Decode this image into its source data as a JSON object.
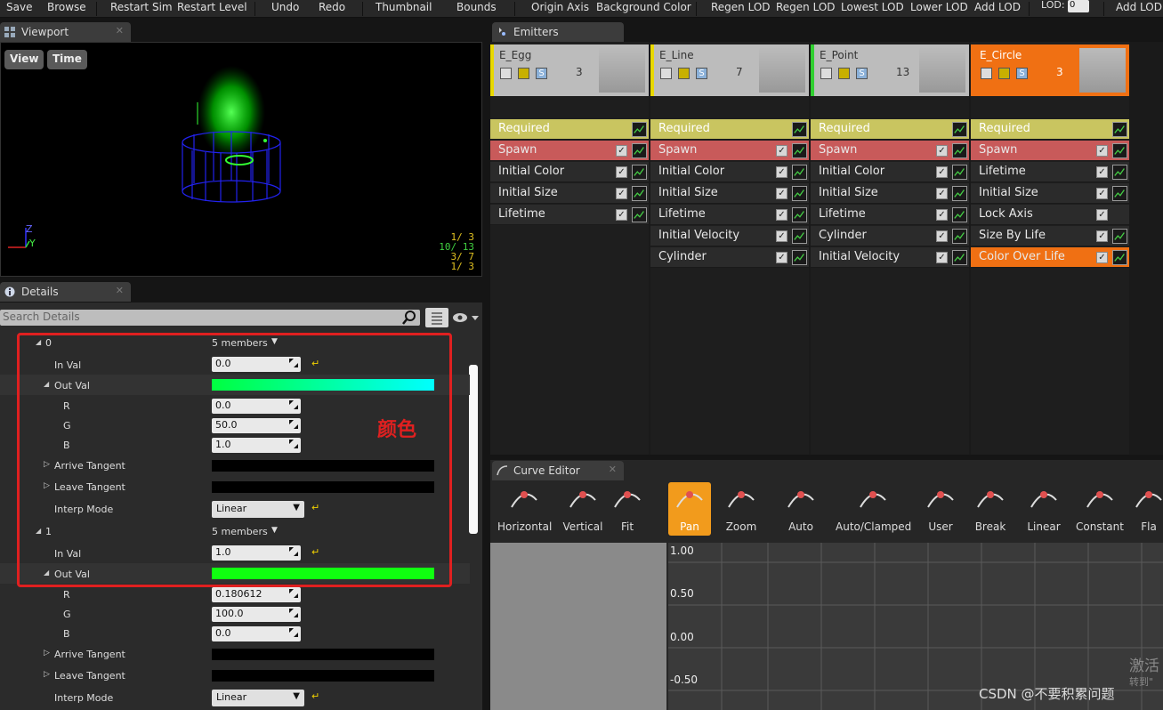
{
  "toolbar": {
    "items": [
      "Save",
      "Browse",
      "Restart Sim",
      "Restart Level",
      "Undo",
      "Redo",
      "Thumbnail",
      "Bounds",
      "Origin Axis",
      "Background Color",
      "Regen LOD",
      "Regen LOD",
      "Lowest LOD",
      "Lower LOD",
      "Add LOD",
      "LOD:",
      "Add LOD"
    ],
    "lod_value": "0"
  },
  "viewport": {
    "tab": "Viewport",
    "buttons": [
      "View",
      "Time"
    ],
    "axis": {
      "z": "Z",
      "y": "Y"
    },
    "stats": [
      {
        "text": "1/ 3",
        "color": "#e0c020"
      },
      {
        "text": "10/ 13",
        "color": "#40d040"
      },
      {
        "text": "3/ 7",
        "color": "#e0c020"
      },
      {
        "text": "1/ 3",
        "color": "#e0c020"
      }
    ]
  },
  "details": {
    "tab": "Details",
    "search_placeholder": "Search Details",
    "annotation": "颜色",
    "rows": [
      {
        "label": "0",
        "kind": "group",
        "value": "5 members"
      },
      {
        "label": "In Val",
        "kind": "num",
        "value": "0.0"
      },
      {
        "label": "Out Val",
        "kind": "color"
      },
      {
        "label": "R",
        "kind": "num",
        "value": "0.0"
      },
      {
        "label": "G",
        "kind": "num",
        "value": "50.0"
      },
      {
        "label": "B",
        "kind": "num",
        "value": "1.0"
      },
      {
        "label": "Arrive Tangent",
        "kind": "bar"
      },
      {
        "label": "Leave Tangent",
        "kind": "bar"
      },
      {
        "label": "Interp Mode",
        "kind": "drop",
        "value": "Linear"
      },
      {
        "label": "1",
        "kind": "group",
        "value": "5 members"
      },
      {
        "label": "In Val",
        "kind": "num",
        "value": "1.0"
      },
      {
        "label": "Out Val",
        "kind": "color"
      },
      {
        "label": "R",
        "kind": "num",
        "value": "0.180612"
      },
      {
        "label": "G",
        "kind": "num",
        "value": "100.0"
      },
      {
        "label": "B",
        "kind": "num",
        "value": "0.0"
      },
      {
        "label": "Arrive Tangent",
        "kind": "bar"
      },
      {
        "label": "Leave Tangent",
        "kind": "bar"
      },
      {
        "label": "Interp Mode",
        "kind": "drop",
        "value": "Linear"
      }
    ]
  },
  "emitters": {
    "tab": "Emitters",
    "columns": [
      {
        "name": "E_Egg",
        "count": "3",
        "stripe": "#e8d800",
        "selected": false,
        "modules": [
          "Required",
          "Spawn",
          "Initial Color",
          "Initial Size",
          "Lifetime"
        ]
      },
      {
        "name": "E_Line",
        "count": "7",
        "stripe": "#e8d800",
        "selected": false,
        "modules": [
          "Required",
          "Spawn",
          "Initial Color",
          "Initial Size",
          "Lifetime",
          "Initial Velocity",
          "Cylinder"
        ]
      },
      {
        "name": "E_Point",
        "count": "13",
        "stripe": "#30d030",
        "selected": false,
        "modules": [
          "Required",
          "Spawn",
          "Initial Color",
          "Initial Size",
          "Lifetime",
          "Cylinder",
          "Initial Velocity"
        ]
      },
      {
        "name": "E_Circle",
        "count": "3",
        "stripe": "#f07013",
        "selected": true,
        "modules": [
          "Required",
          "Spawn",
          "Lifetime",
          "Initial Size",
          "Lock Axis",
          "Size By Life",
          "Color Over Life"
        ]
      }
    ]
  },
  "curve_editor": {
    "tab": "Curve Editor",
    "buttons": [
      "Horizontal",
      "Vertical",
      "Fit",
      "Pan",
      "Zoom",
      "Auto",
      "Auto/Clamped",
      "User",
      "Break",
      "Linear",
      "Constant",
      "Fla"
    ],
    "active": "Pan",
    "y_labels": [
      "1.00",
      "0.50",
      "0.00",
      "-0.50"
    ]
  },
  "watermark": {
    "activate": "激活",
    "goto": "转到\"",
    "csdn": "CSDN @不要积累问题"
  },
  "colors": {
    "accent": "#f07013",
    "required": "#c9c560",
    "spawn": "#c85a5a",
    "highlight_box": "#e02020"
  }
}
